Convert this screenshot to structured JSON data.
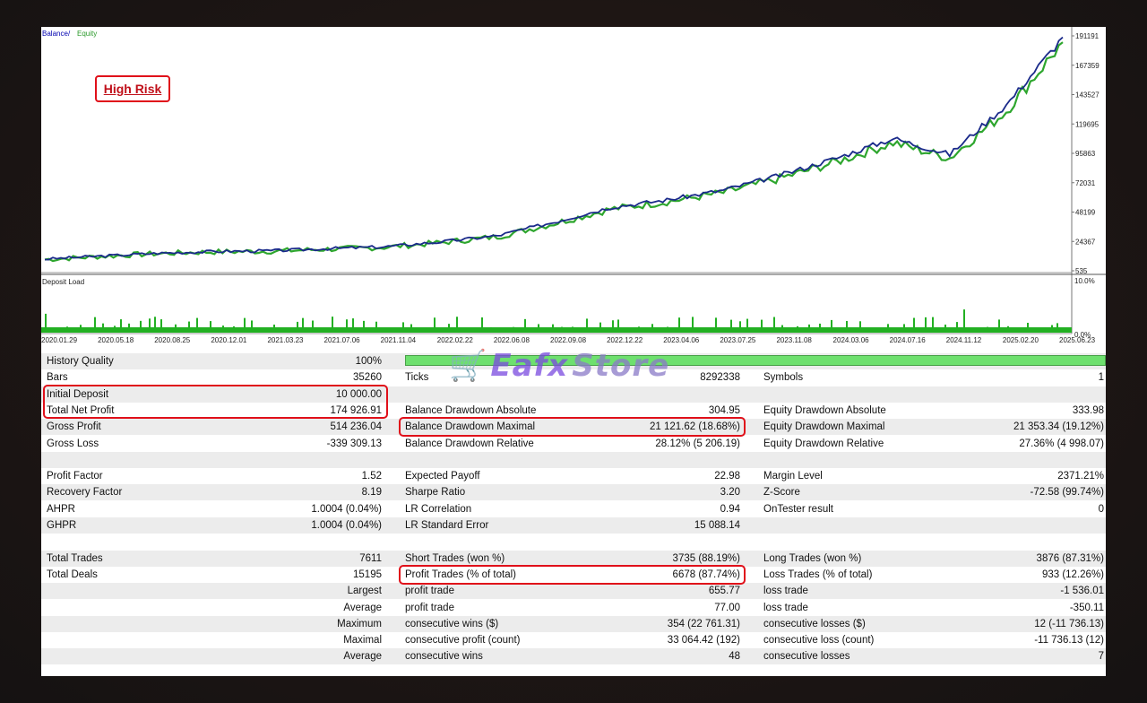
{
  "chart": {
    "title_balance": "Balance",
    "title_sep": " / ",
    "title_equity": "Equity",
    "risk_label": "High Risk",
    "deposit_load_label": "Deposit Load",
    "y_ticks": [
      "191191",
      "167359",
      "143527",
      "119695",
      "95863",
      "72031",
      "48199",
      "24367",
      "535"
    ],
    "load_ticks": [
      "10.0%",
      "0.0%"
    ],
    "x_ticks": [
      "2020.01.29",
      "2020.05.18",
      "2020.08.25",
      "2020.12.01",
      "2021.03.23",
      "2021.07.06",
      "2021.11.04",
      "2022.02.22",
      "2022.06.08",
      "2022.09.08",
      "2022.12.22",
      "2023.04.06",
      "2023.07.25",
      "2023.11.08",
      "2024.03.06",
      "2024.07.16",
      "2024.11.12",
      "2025.02.20",
      "2025.06.23"
    ],
    "colors": {
      "balance": "#1a2a8a",
      "equity": "#2ea62e",
      "load": "#22b022",
      "highlight": "#e0101a"
    }
  },
  "chart_data": {
    "type": "line",
    "x": [
      "2020.01.29",
      "2020.05.18",
      "2020.08.25",
      "2020.12.01",
      "2021.03.23",
      "2021.07.06",
      "2021.11.04",
      "2022.02.22",
      "2022.06.08",
      "2022.09.08",
      "2022.12.22",
      "2023.04.06",
      "2023.07.25",
      "2023.11.08",
      "2024.03.06",
      "2024.07.16",
      "2024.11.12",
      "2025.02.20",
      "2025.06.23"
    ],
    "series": [
      {
        "name": "Balance",
        "values": [
          10000,
          12500,
          14800,
          16200,
          16800,
          18500,
          20000,
          24000,
          29000,
          40000,
          52000,
          58000,
          66000,
          78000,
          92000,
          108000,
          95000,
          135000,
          190000
        ]
      },
      {
        "name": "Equity",
        "values": [
          9700,
          12200,
          14500,
          15900,
          16400,
          18100,
          19600,
          23400,
          28200,
          38800,
          50500,
          56500,
          64000,
          75500,
          89000,
          104500,
          92000,
          130000,
          186000
        ]
      }
    ],
    "ylim": [
      535,
      191191
    ],
    "deposit_load": {
      "ylim": [
        0,
        10
      ],
      "unit": "%"
    }
  },
  "stats": {
    "history_quality": {
      "label": "History Quality",
      "value": "100%"
    },
    "bars": {
      "label": "Bars",
      "value": "35260"
    },
    "ticks": {
      "label": "Ticks",
      "value": "8292338"
    },
    "symbols": {
      "label": "Symbols",
      "value": "1"
    },
    "initial_deposit": {
      "label": "Initial Deposit",
      "value": "10 000.00"
    },
    "total_net_profit": {
      "label": "Total Net Profit",
      "value": "174 926.91"
    },
    "balance_dd_abs": {
      "label": "Balance Drawdown Absolute",
      "value": "304.95"
    },
    "equity_dd_abs": {
      "label": "Equity Drawdown Absolute",
      "value": "333.98"
    },
    "gross_profit": {
      "label": "Gross Profit",
      "value": "514 236.04"
    },
    "balance_dd_max": {
      "label": "Balance Drawdown Maximal",
      "value": "21 121.62 (18.68%)"
    },
    "equity_dd_max": {
      "label": "Equity Drawdown Maximal",
      "value": "21 353.34 (19.12%)"
    },
    "gross_loss": {
      "label": "Gross Loss",
      "value": "-339 309.13"
    },
    "balance_dd_rel": {
      "label": "Balance Drawdown Relative",
      "value": "28.12% (5 206.19)"
    },
    "equity_dd_rel": {
      "label": "Equity Drawdown Relative",
      "value": "27.36% (4 998.07)"
    },
    "profit_factor": {
      "label": "Profit Factor",
      "value": "1.52"
    },
    "expected_payoff": {
      "label": "Expected Payoff",
      "value": "22.98"
    },
    "margin_level": {
      "label": "Margin Level",
      "value": "2371.21%"
    },
    "recovery_factor": {
      "label": "Recovery Factor",
      "value": "8.19"
    },
    "sharpe_ratio": {
      "label": "Sharpe Ratio",
      "value": "3.20"
    },
    "z_score": {
      "label": "Z-Score",
      "value": "-72.58 (99.74%)"
    },
    "ahpr": {
      "label": "AHPR",
      "value": "1.0004 (0.04%)"
    },
    "lr_correlation": {
      "label": "LR Correlation",
      "value": "0.94"
    },
    "ontester": {
      "label": "OnTester result",
      "value": "0"
    },
    "ghpr": {
      "label": "GHPR",
      "value": "1.0004 (0.04%)"
    },
    "lr_std_error": {
      "label": "LR Standard Error",
      "value": "15 088.14"
    },
    "total_trades": {
      "label": "Total Trades",
      "value": "7611"
    },
    "short_trades": {
      "label": "Short Trades (won %)",
      "value": "3735 (88.19%)"
    },
    "long_trades": {
      "label": "Long Trades (won %)",
      "value": "3876 (87.31%)"
    },
    "total_deals": {
      "label": "Total Deals",
      "value": "15195"
    },
    "profit_trades": {
      "label": "Profit Trades (% of total)",
      "value": "6678 (87.74%)"
    },
    "loss_trades": {
      "label": "Loss Trades (% of total)",
      "value": "933 (12.26%)"
    },
    "largest": {
      "label": "Largest",
      "l2": "profit trade",
      "v2": "655.77",
      "l3": "loss trade",
      "v3": "-1 536.01"
    },
    "average": {
      "label": "Average",
      "l2": "profit trade",
      "v2": "77.00",
      "l3": "loss trade",
      "v3": "-350.11"
    },
    "maximum": {
      "label": "Maximum",
      "l2": "consecutive wins ($)",
      "v2": "354 (22 761.31)",
      "l3": "consecutive losses ($)",
      "v3": "12 (-11 736.13)"
    },
    "maximal": {
      "label": "Maximal",
      "l2": "consecutive profit (count)",
      "v2": "33 064.42 (192)",
      "l3": "consecutive loss (count)",
      "v3": "-11 736.13 (12)"
    },
    "average2": {
      "label": "Average",
      "l2": "consecutive wins",
      "v2": "48",
      "l3": "consecutive losses",
      "v3": "7"
    }
  },
  "watermark": {
    "text1": "Eafx",
    "text2": "Store"
  }
}
